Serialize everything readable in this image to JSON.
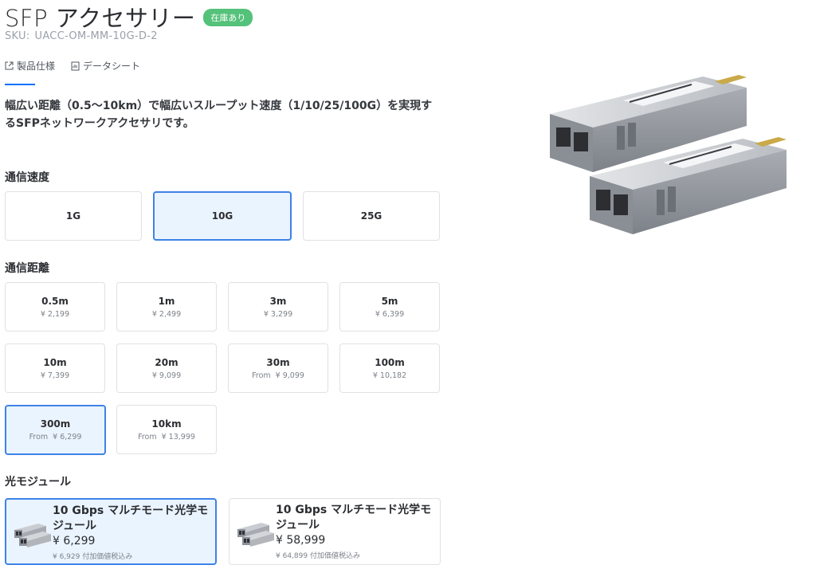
{
  "product": {
    "title": "SFP アクセサリー",
    "stock_badge": "在庫あり",
    "sku_label": "SKU:",
    "sku_value": "UACC-OM-MM-10G-D-2",
    "description": "幅広い距離（0.5〜10km）で幅広いスループット速度（1/10/25/100G）を実現するSFPネットワークアクセサリです。"
  },
  "tabs": [
    {
      "label": "製品仕様",
      "icon": "external-link-icon"
    },
    {
      "label": "データシート",
      "icon": "datasheet-icon"
    }
  ],
  "speed": {
    "label": "通信速度",
    "options": [
      {
        "name": "1G",
        "selected": false
      },
      {
        "name": "10G",
        "selected": true
      },
      {
        "name": "25G",
        "selected": false
      }
    ]
  },
  "distance": {
    "label": "通信距離",
    "options": [
      {
        "name": "0.5m",
        "from": "",
        "price": "¥ 2,199",
        "selected": false
      },
      {
        "name": "1m",
        "from": "",
        "price": "¥ 2,499",
        "selected": false
      },
      {
        "name": "3m",
        "from": "",
        "price": "¥ 3,299",
        "selected": false
      },
      {
        "name": "5m",
        "from": "",
        "price": "¥ 6,399",
        "selected": false
      },
      {
        "name": "10m",
        "from": "",
        "price": "¥ 7,399",
        "selected": false
      },
      {
        "name": "20m",
        "from": "",
        "price": "¥ 9,099",
        "selected": false
      },
      {
        "name": "30m",
        "from": "From",
        "price": "¥ 9,099",
        "selected": false
      },
      {
        "name": "100m",
        "from": "",
        "price": "¥ 10,182",
        "selected": false
      },
      {
        "name": "300m",
        "from": "From",
        "price": "¥ 6,299",
        "selected": true
      },
      {
        "name": "10km",
        "from": "From",
        "price": "¥ 13,999",
        "selected": false
      }
    ]
  },
  "modules": {
    "label": "光モジュール",
    "options": [
      {
        "name": "10 Gbps マルチモード光学モジュール",
        "price": "¥ 6,299",
        "note": "¥ 6,929 付加価値税込み",
        "selected": true
      },
      {
        "name": "10 Gbps マルチモード光学モジュール",
        "price": "¥ 58,999",
        "note": "¥ 64,899 付加価値税込み",
        "selected": false
      }
    ]
  },
  "colors": {
    "accent": "#006fff",
    "selected_border": "#3e82e8",
    "selected_bg": "#eaf4fe",
    "stock_badge": "#54c27a"
  }
}
